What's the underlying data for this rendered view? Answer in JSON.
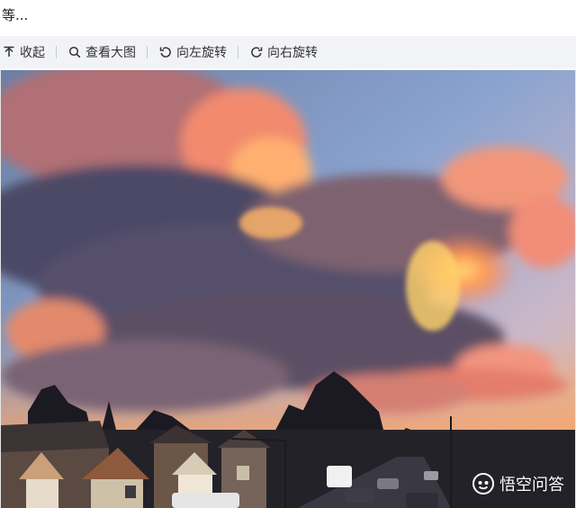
{
  "post": {
    "trailing_text": "等..."
  },
  "toolbar": {
    "items": [
      {
        "label": "收起",
        "icon": "collapse-icon"
      },
      {
        "label": "查看大图",
        "icon": "magnifier-icon"
      },
      {
        "label": "向左旋转",
        "icon": "rotate-left-icon"
      },
      {
        "label": "向右旋转",
        "icon": "rotate-right-icon"
      }
    ]
  },
  "image": {
    "subject": "sunset-clouds-over-suburban-street",
    "watermark": {
      "text": "悟空问答",
      "icon": "wukong-logo-icon"
    }
  },
  "colors": {
    "toolbar_bg": "#f2f3f7",
    "text": "#333333"
  }
}
